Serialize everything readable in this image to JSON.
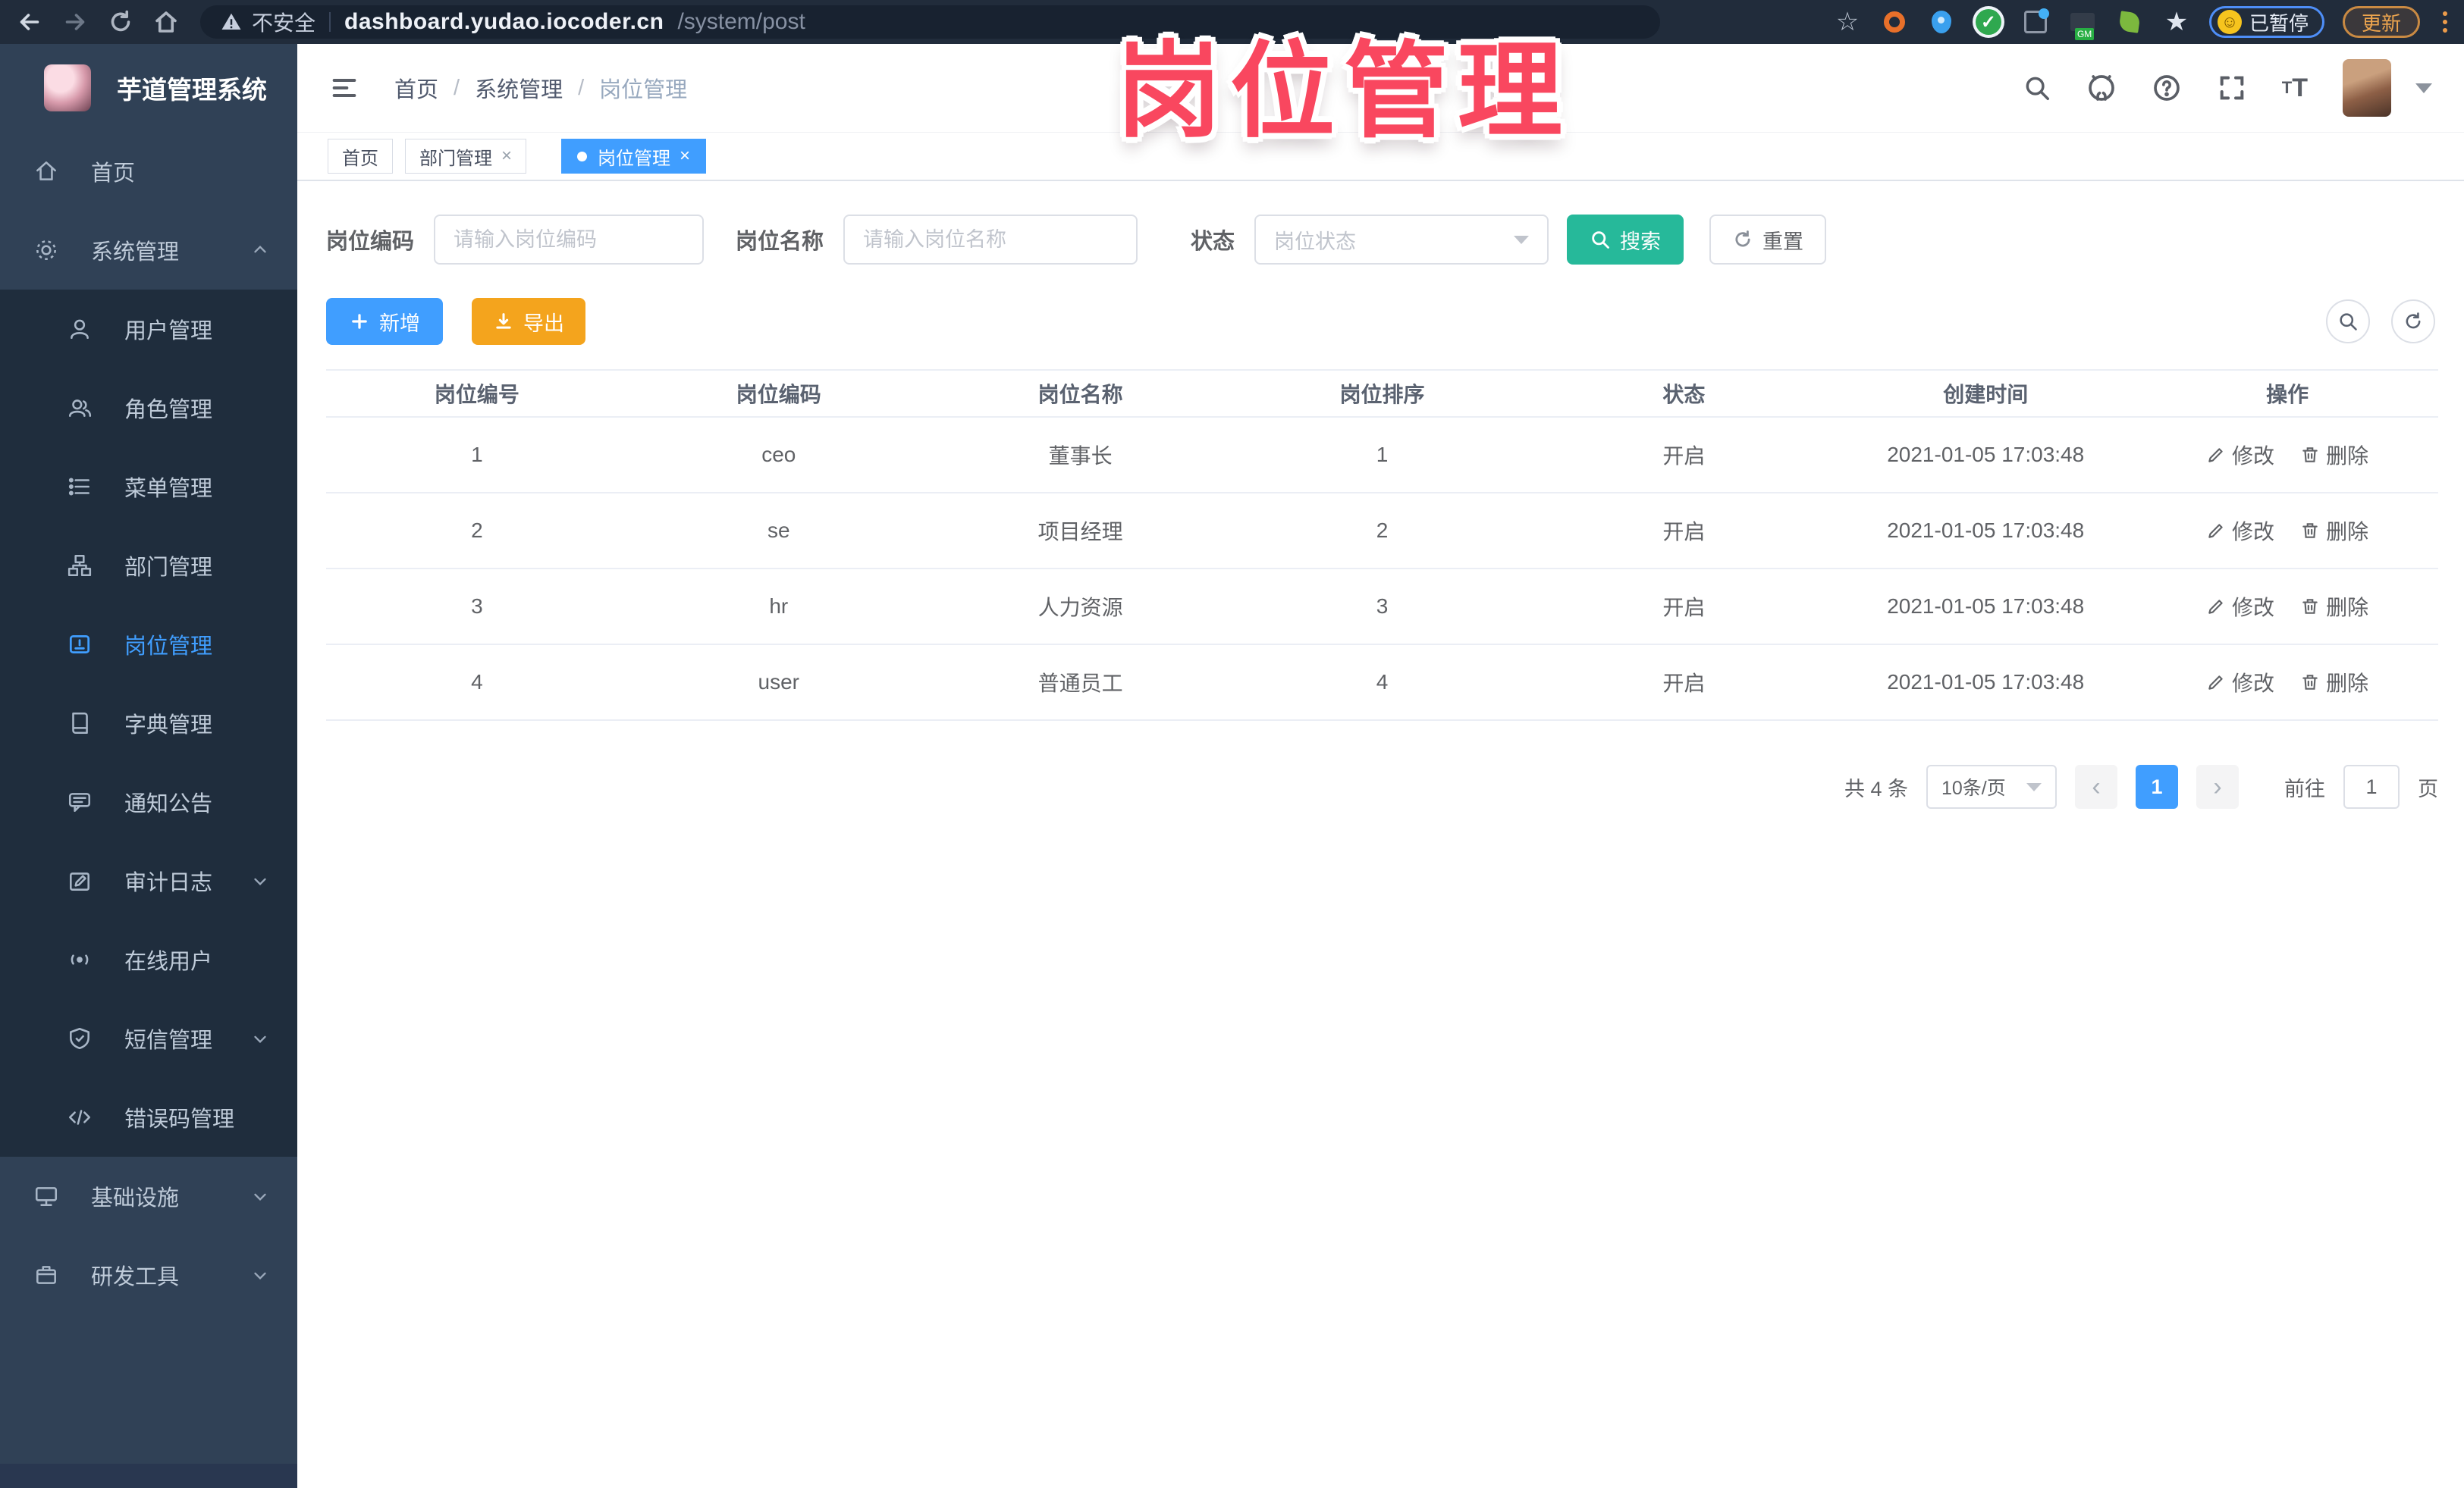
{
  "browser": {
    "security_label": "不安全",
    "url_host": "dashboard.yudao.iocoder.cn",
    "url_path": "/system/post",
    "paused_label": "已暂停",
    "update_label": "更新"
  },
  "annotation": {
    "text": "岗位管理",
    "color": "#f9475f"
  },
  "sidebar": {
    "title": "芋道管理系统",
    "items": [
      {
        "label": "首页",
        "icon": "home-icon"
      },
      {
        "label": "系统管理",
        "icon": "gear-icon",
        "chevron": "up"
      },
      {
        "label": "用户管理",
        "icon": "user-icon"
      },
      {
        "label": "角色管理",
        "icon": "roles-icon"
      },
      {
        "label": "菜单管理",
        "icon": "menu-list-icon"
      },
      {
        "label": "部门管理",
        "icon": "org-tree-icon"
      },
      {
        "label": "岗位管理",
        "icon": "post-icon",
        "active": true
      },
      {
        "label": "字典管理",
        "icon": "dictionary-icon"
      },
      {
        "label": "通知公告",
        "icon": "announcement-icon"
      },
      {
        "label": "审计日志",
        "icon": "audit-log-icon",
        "chevron": "down"
      },
      {
        "label": "在线用户",
        "icon": "online-users-icon"
      },
      {
        "label": "短信管理",
        "icon": "sms-shield-icon",
        "chevron": "down"
      },
      {
        "label": "错误码管理",
        "icon": "error-code-icon"
      },
      {
        "label": "基础设施",
        "icon": "infrastructure-icon",
        "chevron": "down"
      },
      {
        "label": "研发工具",
        "icon": "dev-tools-icon",
        "chevron": "down"
      }
    ]
  },
  "header": {
    "breadcrumb": [
      "首页",
      "系统管理",
      "岗位管理"
    ]
  },
  "tabs": [
    {
      "label": "首页"
    },
    {
      "label": "部门管理"
    },
    {
      "label": "岗位管理"
    }
  ],
  "filters": {
    "code_label": "岗位编码",
    "code_placeholder": "请输入岗位编码",
    "name_label": "岗位名称",
    "name_placeholder": "请输入岗位名称",
    "status_label": "状态",
    "status_placeholder": "岗位状态",
    "search_label": "搜索",
    "reset_label": "重置"
  },
  "toolbar": {
    "add_label": "新增",
    "export_label": "导出"
  },
  "table": {
    "columns": [
      "岗位编号",
      "岗位编码",
      "岗位名称",
      "岗位排序",
      "状态",
      "创建时间",
      "操作"
    ],
    "rows": [
      [
        "1",
        "ceo",
        "董事长",
        "1",
        "开启",
        "2021-01-05 17:03:48"
      ],
      [
        "2",
        "se",
        "项目经理",
        "2",
        "开启",
        "2021-01-05 17:03:48"
      ],
      [
        "3",
        "hr",
        "人力资源",
        "3",
        "开启",
        "2021-01-05 17:03:48"
      ],
      [
        "4",
        "user",
        "普通员工",
        "4",
        "开启",
        "2021-01-05 17:03:48"
      ]
    ],
    "edit_label": "修改",
    "delete_label": "删除"
  },
  "pagination": {
    "total_text": "共 4 条",
    "page_size": "10条/页",
    "current_page": "1",
    "goto_label": "前往",
    "goto_value": "1",
    "page_unit": "页"
  },
  "colors": {
    "accent_blue": "#409eff",
    "search_teal": "#26b99a",
    "export_orange": "#f4a41d",
    "sidebar_bg": "#304156",
    "submenu_bg": "#1f2d3d"
  }
}
